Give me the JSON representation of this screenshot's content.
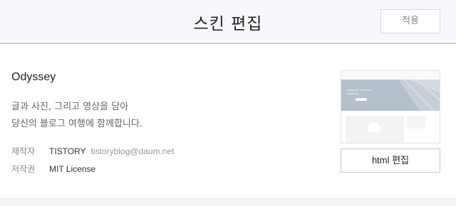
{
  "header": {
    "title": "스킨 편집",
    "apply_label": "적용"
  },
  "skin": {
    "name": "Odyssey",
    "description": [
      "글과 사진, 그리고 영상을 담아",
      "당신의 블로그 여행에 함께합니다."
    ],
    "meta": {
      "maker_label": "제작자",
      "maker": "TISTORY",
      "email": "tistoryblog@daum.net",
      "copyright_label": "저작권",
      "license": "MIT License"
    },
    "thumbnail": {
      "icon": "skin-preview-thumbnail",
      "headline": [
        "Welcome to the Tid",
        "Odyssey"
      ]
    },
    "edit_label": "html 편집"
  },
  "colors": {
    "header_bg": "#f7f8fb",
    "header_border": "#c9cfde",
    "hero": "#b4c0cc"
  }
}
